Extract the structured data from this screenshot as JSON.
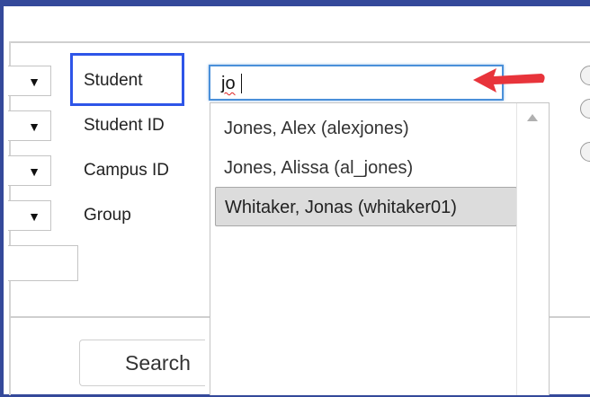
{
  "filters": {
    "labels": [
      "Student",
      "Student ID",
      "Campus ID",
      "Group"
    ],
    "dropdown_arrow": "▼"
  },
  "search": {
    "value": "jo"
  },
  "suggestions": [
    {
      "label": "Jones, Alex (alexjones)",
      "selected": false
    },
    {
      "label": "Jones, Alissa (al_jones)",
      "selected": false
    },
    {
      "label": "Whitaker, Jonas (whitaker01)",
      "selected": true
    }
  ],
  "search_button": {
    "label": "Search"
  },
  "annotation": {
    "highlight_color": "#2e55e8",
    "arrow_color": "#e8343b"
  },
  "icons": [
    "chevron-down-icon",
    "scroll-up-icon",
    "red-arrow-icon"
  ]
}
